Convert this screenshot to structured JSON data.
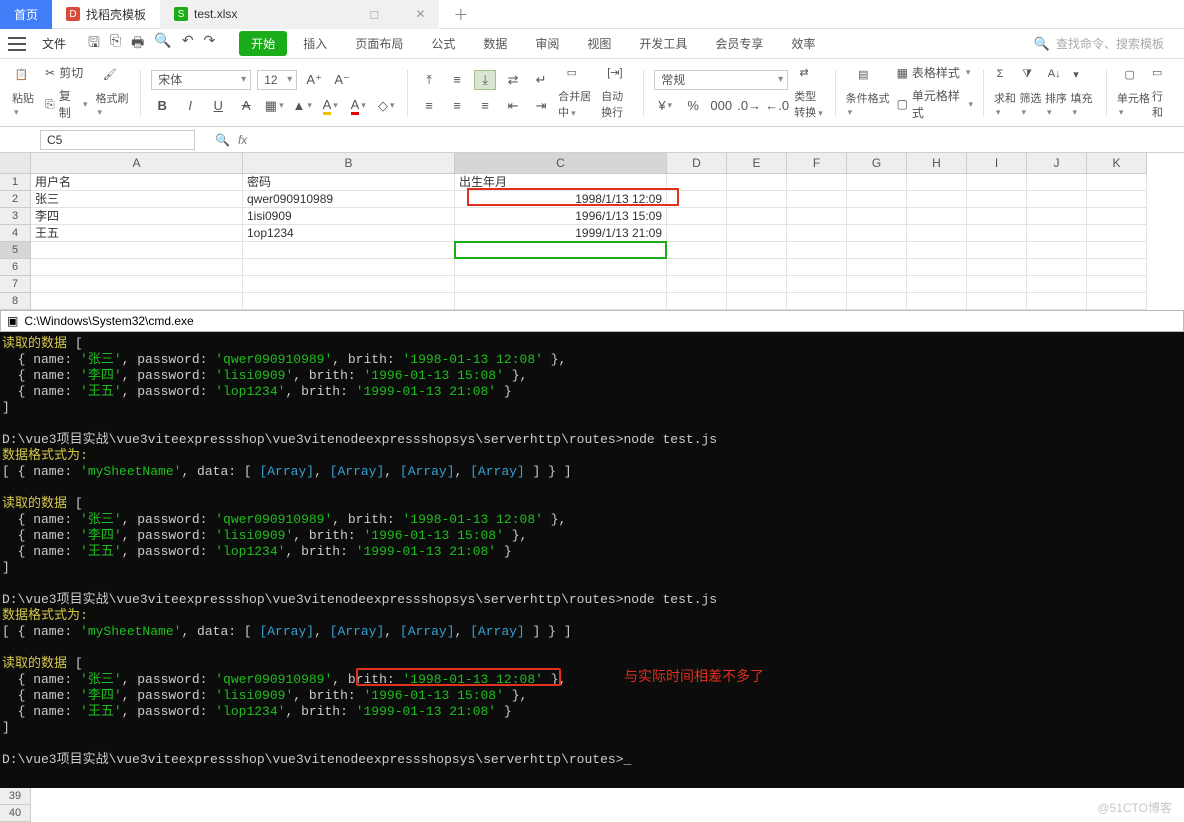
{
  "tabs": {
    "home": "首页",
    "template": "找稻壳模板",
    "file": "test.xlsx"
  },
  "menubar": {
    "file": "文件",
    "search_placeholder": "查找命令、搜索模板"
  },
  "ribbon_tabs": [
    "开始",
    "插入",
    "页面布局",
    "公式",
    "数据",
    "审阅",
    "视图",
    "开发工具",
    "会员专享",
    "效率"
  ],
  "ribbon": {
    "paste": "粘贴",
    "cut": "剪切",
    "copy": "复制",
    "format_painter": "格式刷",
    "font_name": "宋体",
    "font_size": "12",
    "merge": "合并居中",
    "wrap": "自动换行",
    "number_format": "常规",
    "type_convert": "类型转换",
    "cond_format": "条件格式",
    "table_style": "表格样式",
    "cell_style": "单元格样式",
    "sum": "求和",
    "filter": "筛选",
    "sort": "排序",
    "fill": "填充",
    "cell": "单元格",
    "row_col": "行和"
  },
  "namebox": "C5",
  "columns": [
    "A",
    "B",
    "C",
    "D",
    "E",
    "F",
    "G",
    "H",
    "I",
    "J",
    "K"
  ],
  "rows": [
    "1",
    "2",
    "3",
    "4",
    "5",
    "6",
    "7",
    "8"
  ],
  "sheet": {
    "headers": {
      "a": "用户名",
      "b": "密码",
      "c": "出生年月"
    },
    "r2": {
      "a": "张三",
      "b": "qwer090910989",
      "c": "1998/1/13 12:09"
    },
    "r3": {
      "a": "李四",
      "b": "1isi0909",
      "c": "1996/1/13 15:09"
    },
    "r4": {
      "a": "王五",
      "b": "1op1234",
      "c": "1999/1/13 21:09"
    }
  },
  "cmd": {
    "title": "C:\\Windows\\System32\\cmd.exe",
    "read_label": "读取的数据",
    "format_label": "数据格式式为:",
    "prompt_path": "D:\\vue3项目实战\\vue3viteexpressshop\\vue3vitenodeexpressshopsys\\serverhttp\\routes>",
    "node_cmd": "node test.js",
    "sheet_name": "mySheetName",
    "arr": "[Array]",
    "rows": [
      {
        "name": "张三",
        "pwd": "qwer090910989",
        "brith": "1998-01-13 12:08"
      },
      {
        "name": "李四",
        "pwd": "lisi0909",
        "brith": "1996-01-13 15:08"
      },
      {
        "name": "王五",
        "pwd": "lop1234",
        "brith": "1999-01-13 21:08"
      }
    ],
    "annotation": "与实际时间相差不多了"
  },
  "bottom_rows": [
    "39",
    "40"
  ],
  "watermark": "@51CTO博客"
}
